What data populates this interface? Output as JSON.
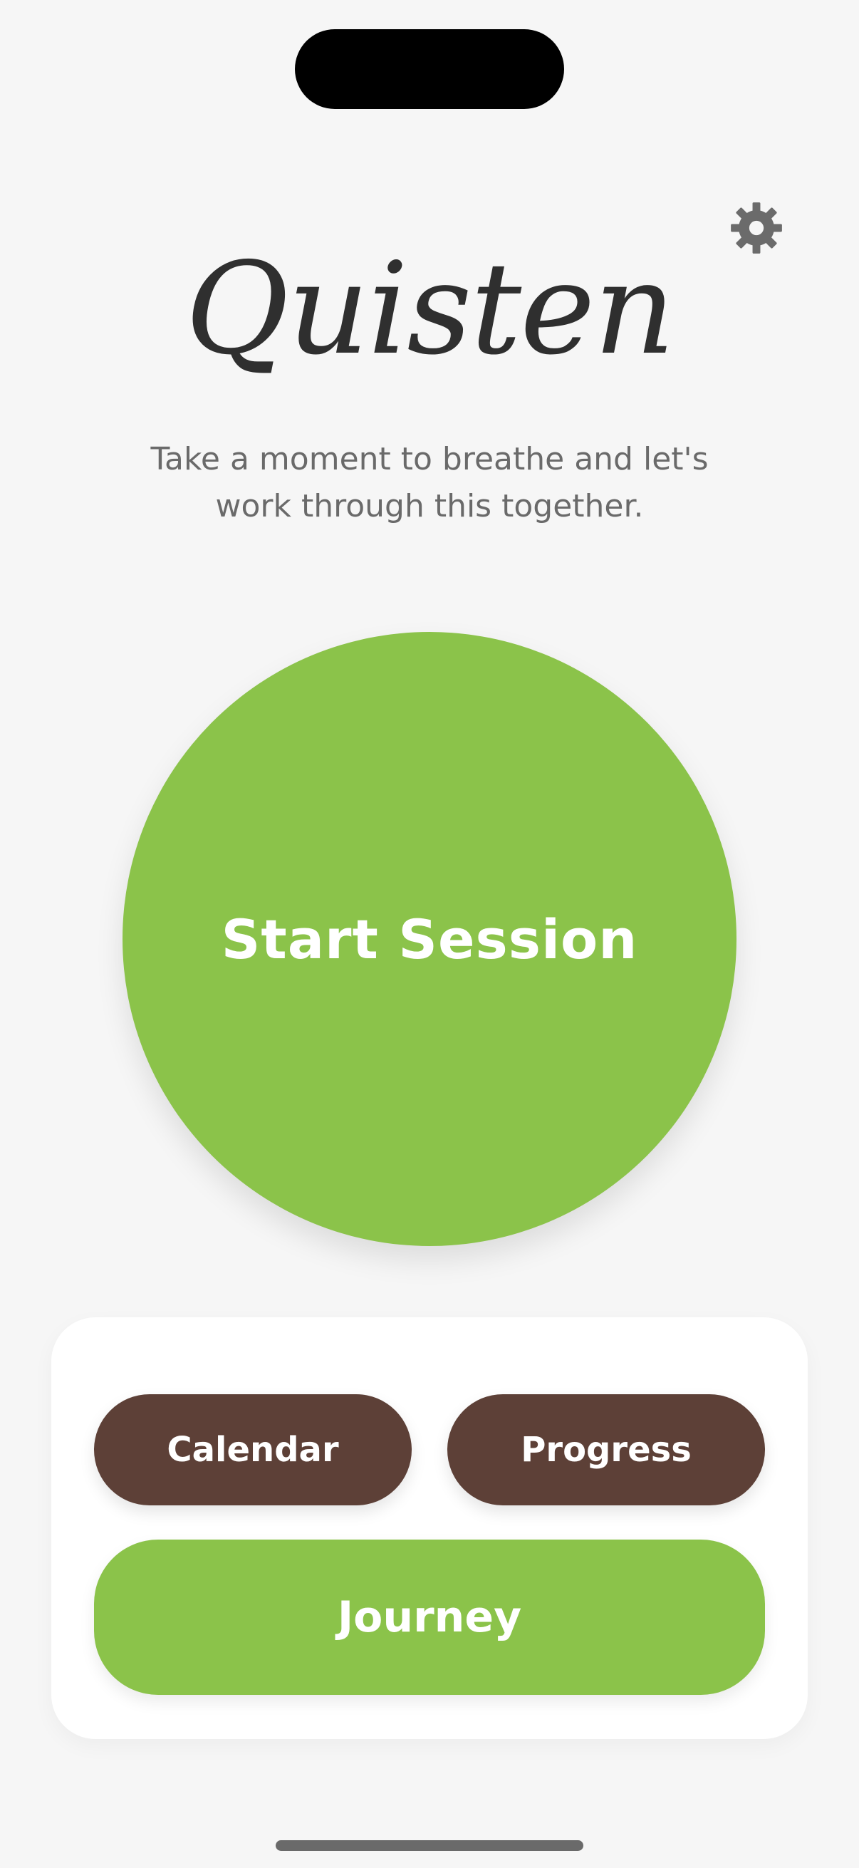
{
  "app": {
    "title": "Quisten",
    "subtitle": "Take a moment to breathe and let's work through this together."
  },
  "header": {
    "settings_icon": "gear-icon"
  },
  "main": {
    "start_button_label": "Start Session"
  },
  "nav_card": {
    "calendar_label": "Calendar",
    "progress_label": "Progress",
    "journey_label": "Journey"
  },
  "colors": {
    "accent_green": "#8bc34a",
    "brown": "#5d4037",
    "background": "#f6f6f6",
    "card": "#ffffff",
    "title_text": "#2f2f2f",
    "subtitle_text": "#6a6a6a"
  }
}
